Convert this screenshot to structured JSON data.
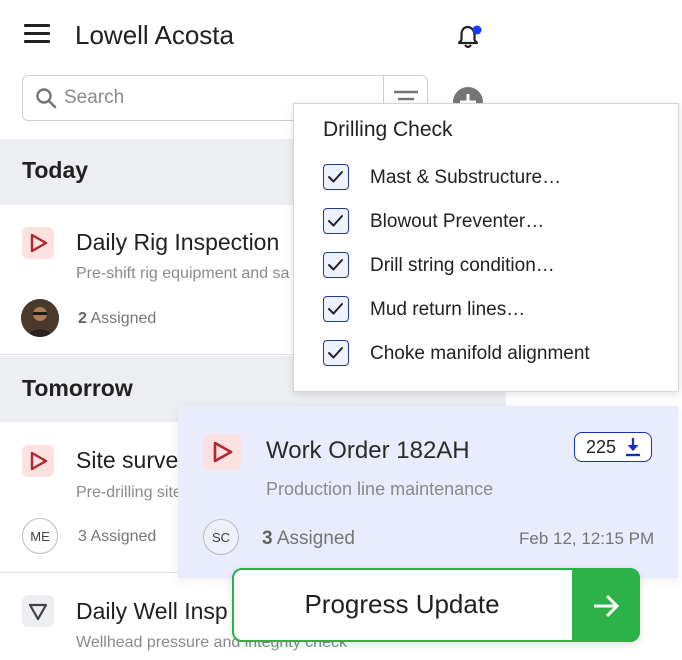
{
  "header": {
    "title": "Lowell Acosta"
  },
  "search": {
    "placeholder": "Search"
  },
  "sections": {
    "today": "Today",
    "tomorrow": "Tomorrow"
  },
  "rows": [
    {
      "title": "Daily Rig Inspection",
      "subtitle": "Pre-shift rig equipment and sa",
      "assigned_count": "2",
      "assigned_label": "Assigned"
    },
    {
      "title": "Site surve",
      "subtitle": "Pre-drilling site",
      "assigned_count": "3",
      "assigned_label": "Assigned",
      "avatar": "ME"
    },
    {
      "title": "Daily Well Insp",
      "subtitle": "Wellhead pressure and integrity check"
    }
  ],
  "popover": {
    "title": "Drilling Check",
    "items": [
      {
        "label": "Mast & Substructure…",
        "checked": true
      },
      {
        "label": "Blowout Preventer…",
        "checked": true
      },
      {
        "label": "Drill string condition…",
        "checked": true
      },
      {
        "label": "Mud return lines…",
        "checked": true
      },
      {
        "label": "Choke manifold alignment",
        "checked": true
      }
    ]
  },
  "work_order": {
    "title": "Work Order 182AH",
    "subtitle": "Production line maintenance",
    "count": "225",
    "avatar": "SC",
    "assigned_count": "3",
    "assigned_label": "Assigned",
    "date": "Feb 12, 12:15 PM"
  },
  "progress_button": {
    "label": "Progress Update"
  },
  "colors": {
    "accent_green": "#2db24a",
    "accent_blue": "#1a2fb8",
    "notification_dot": "#1a3cff",
    "play_red": "#b3262e",
    "card_bg": "#e9ecfc"
  }
}
